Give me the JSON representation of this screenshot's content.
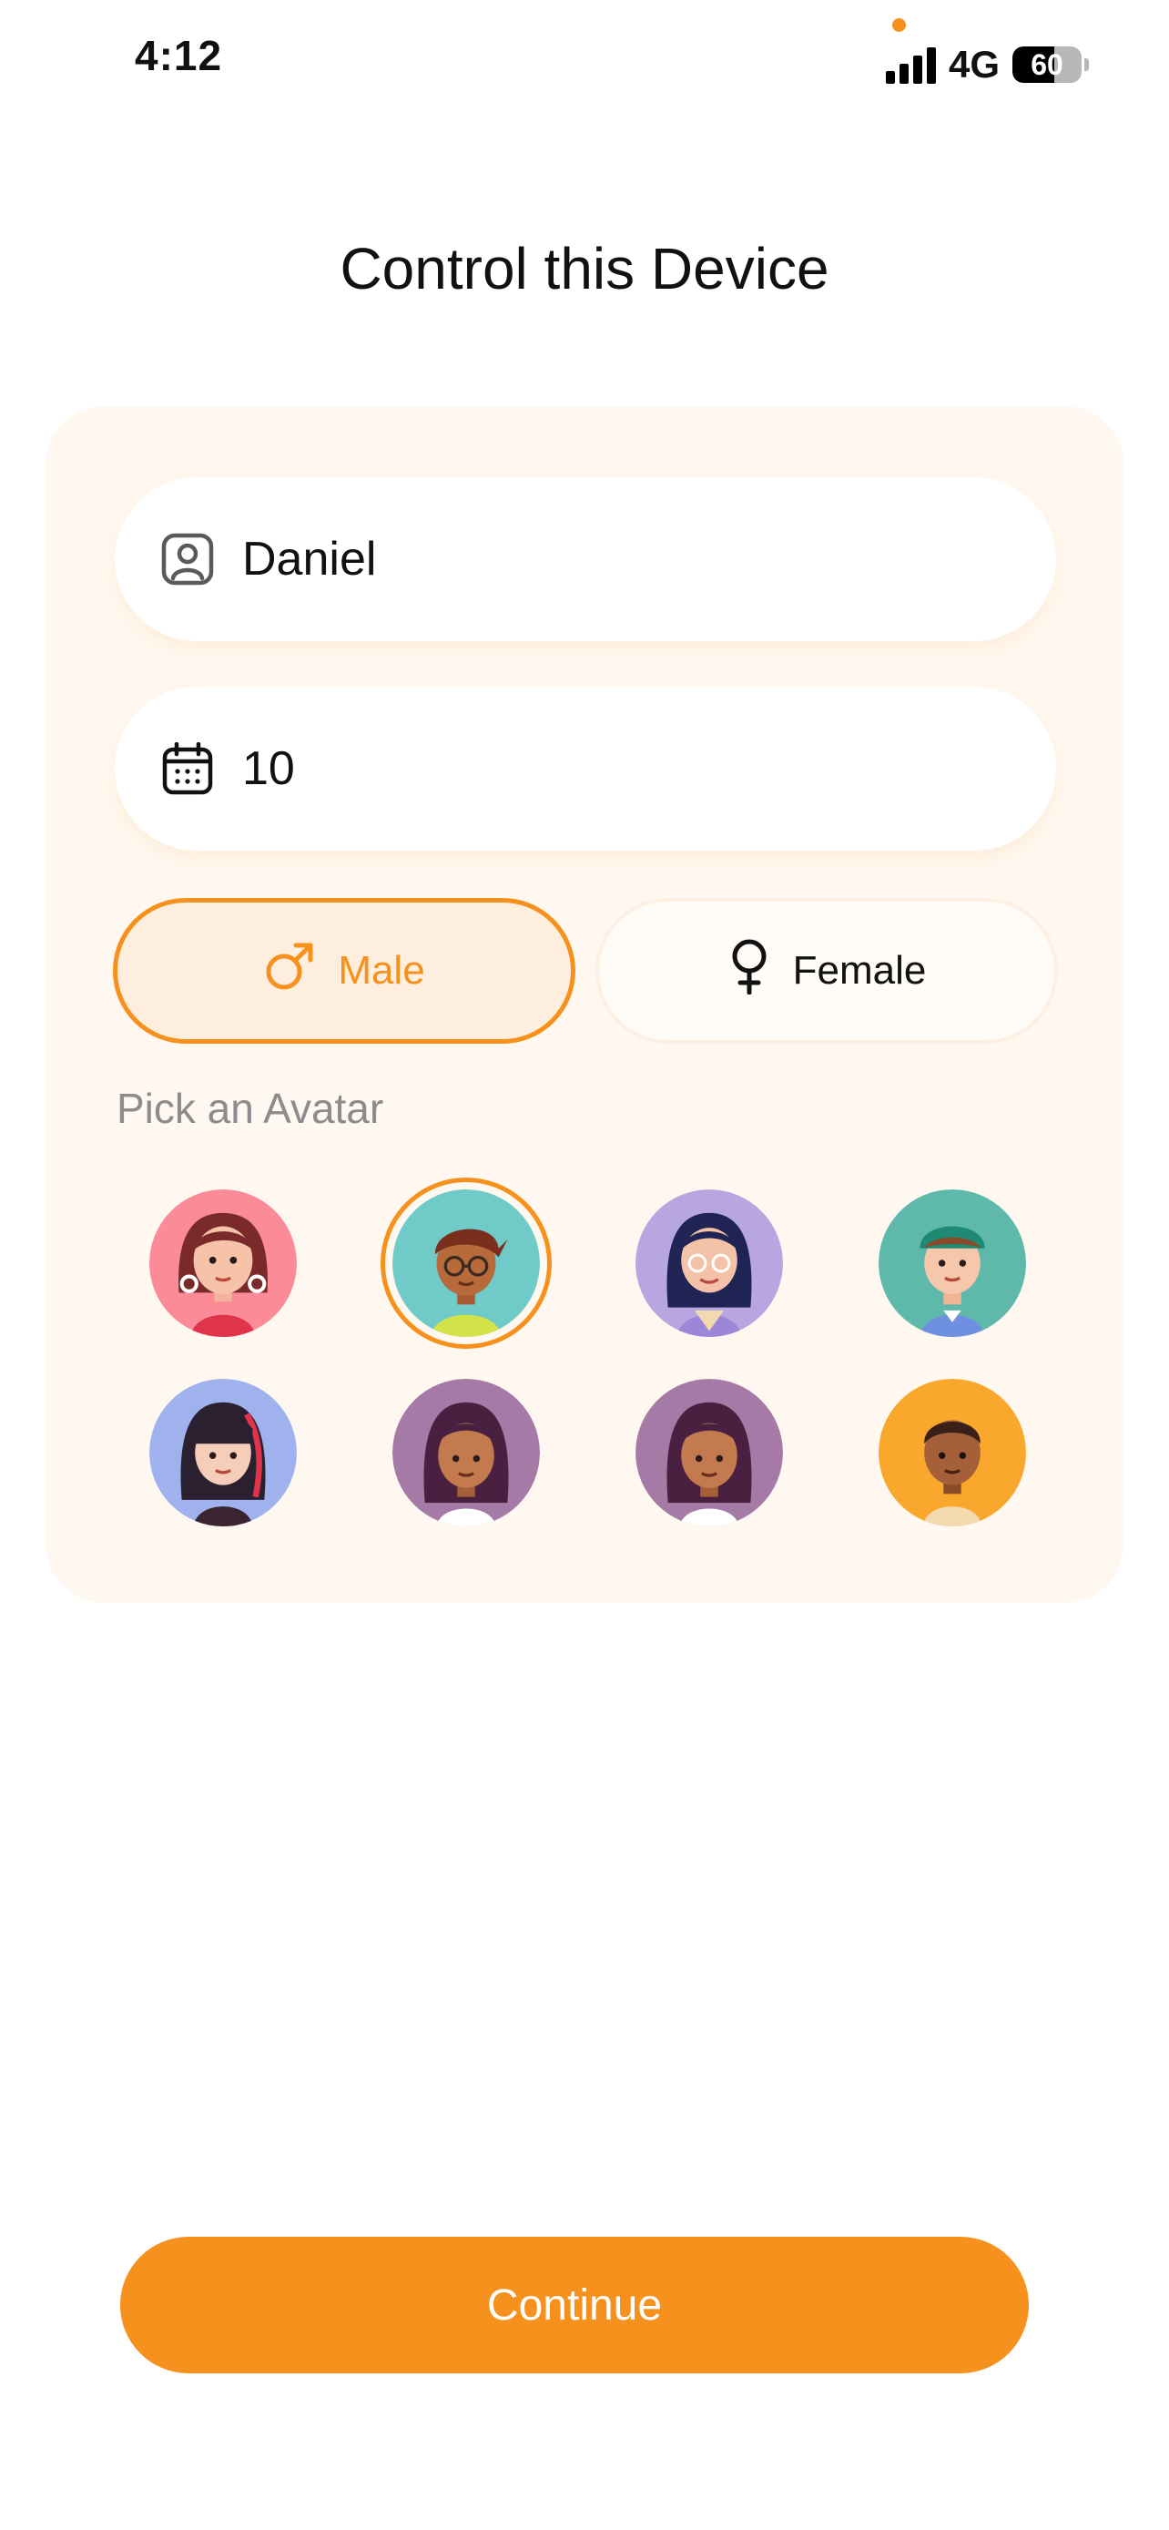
{
  "status_bar": {
    "time": "4:12",
    "network": "4G",
    "battery": "60",
    "battery_level_percent": 60,
    "signal_bars": 4,
    "privacy_dot_color": "#f6911e"
  },
  "page": {
    "title": "Control this Device"
  },
  "form": {
    "name_field": {
      "value": "Daniel",
      "icon": "user-square-icon"
    },
    "age_field": {
      "value": "10",
      "icon": "calendar-icon"
    },
    "gender": {
      "male_label": "Male",
      "female_label": "Female",
      "selected": "Male",
      "male_icon": "male-symbol-icon",
      "female_icon": "female-symbol-icon"
    },
    "avatar_label": "Pick an Avatar",
    "avatars": [
      {
        "id": "girl-red-bg",
        "bg": "#fb8b97",
        "selected": false
      },
      {
        "id": "boy-glasses-teal-bg",
        "bg": "#6fcac8",
        "selected": true
      },
      {
        "id": "girl-glasses-purple-bg",
        "bg": "#b7a6e0",
        "selected": false
      },
      {
        "id": "boy-cap-green-bg",
        "bg": "#5fb9ab",
        "selected": false
      },
      {
        "id": "girl-bangs-blue-bg",
        "bg": "#9fb2ee",
        "selected": false
      },
      {
        "id": "girl-dark-mauve-bg",
        "bg": "#a57aa6",
        "selected": false
      },
      {
        "id": "girl-dark-mauve-bg-2",
        "bg": "#a57aa6",
        "selected": false
      },
      {
        "id": "boy-orange-bg",
        "bg": "#f9a82d",
        "selected": false
      }
    ]
  },
  "actions": {
    "continue_label": "Continue"
  },
  "colors": {
    "accent": "#f6911e",
    "card_bg": "#fff8f0",
    "male_selected_bg": "#fdeede",
    "muted_text": "#8c8c8c"
  }
}
